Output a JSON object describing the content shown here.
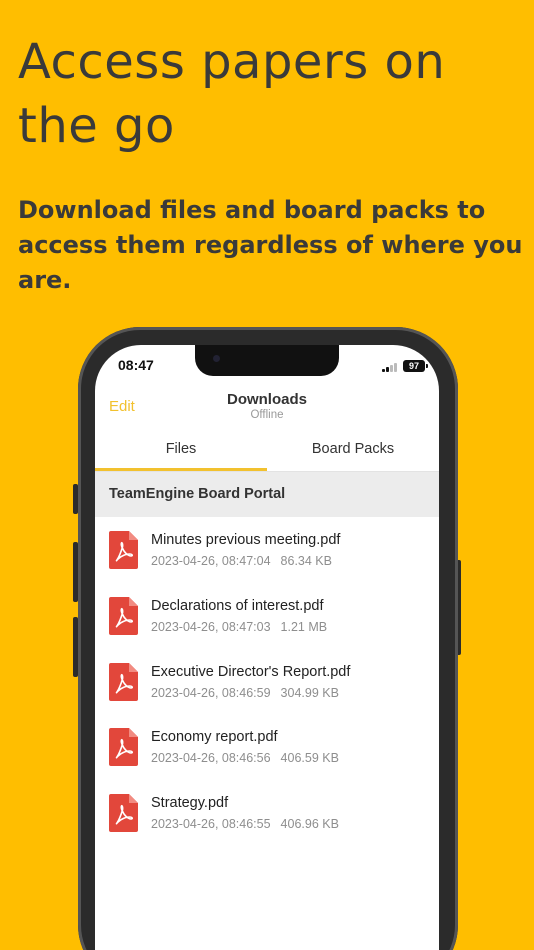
{
  "promo": {
    "headline": "Access papers on the go",
    "subline": "Download files and board packs to access them regardless of where you are."
  },
  "status_bar": {
    "time": "08:47",
    "battery": "97"
  },
  "nav": {
    "edit_label": "Edit",
    "title": "Downloads",
    "subtitle": "Offline"
  },
  "tabs": [
    {
      "label": "Files",
      "selected": true
    },
    {
      "label": "Board Packs",
      "selected": false
    }
  ],
  "section": {
    "title": "TeamEngine Board Portal"
  },
  "files": [
    {
      "name": "Minutes previous meeting.pdf",
      "date": "2023-04-26, 08:47:04",
      "size": "86.34 KB",
      "icon": "pdf-icon"
    },
    {
      "name": "Declarations of interest.pdf",
      "date": "2023-04-26, 08:47:03",
      "size": "1.21 MB",
      "icon": "pdf-icon"
    },
    {
      "name": "Executive Director's Report.pdf",
      "date": "2023-04-26, 08:46:59",
      "size": "304.99 KB",
      "icon": "pdf-icon"
    },
    {
      "name": "Economy report.pdf",
      "date": "2023-04-26, 08:46:56",
      "size": "406.59 KB",
      "icon": "pdf-icon"
    },
    {
      "name": "Strategy.pdf",
      "date": "2023-04-26, 08:46:55",
      "size": "406.96 KB",
      "icon": "pdf-icon"
    }
  ],
  "colors": {
    "background": "#FFBE00",
    "accent": "#F2C12E",
    "pdf_red": "#E2473B"
  }
}
